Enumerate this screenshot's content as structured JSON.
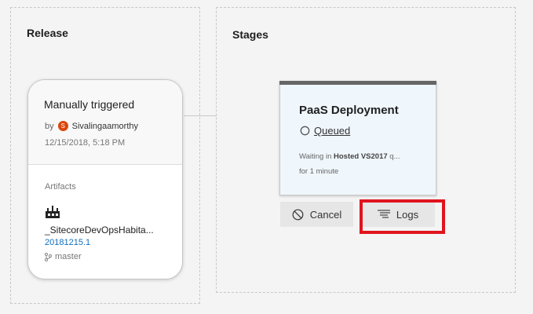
{
  "release": {
    "section_title": "Release",
    "trigger": "Manually triggered",
    "by_label": "by",
    "avatar_initial": "S",
    "author": "Sivalingaamorthy",
    "date": "12/15/2018, 5:18 PM",
    "artifacts_label": "Artifacts",
    "artifact_name": "_SitecoreDevOpsHabita...",
    "artifact_version": "20181215.1",
    "branch": "master"
  },
  "stages": {
    "section_title": "Stages",
    "stage_name": "PaaS Deployment",
    "status": "Queued",
    "wait_prefix": "Waiting in",
    "wait_pool": "Hosted VS2017",
    "wait_suffix": "q...",
    "wait_duration": "for 1 minute"
  },
  "buttons": {
    "cancel": "Cancel",
    "logs": "Logs"
  },
  "colors": {
    "avatar": "#d9470b",
    "link": "#106ebe",
    "highlight": "#e0141e",
    "stage_bg": "#eff6fc"
  }
}
